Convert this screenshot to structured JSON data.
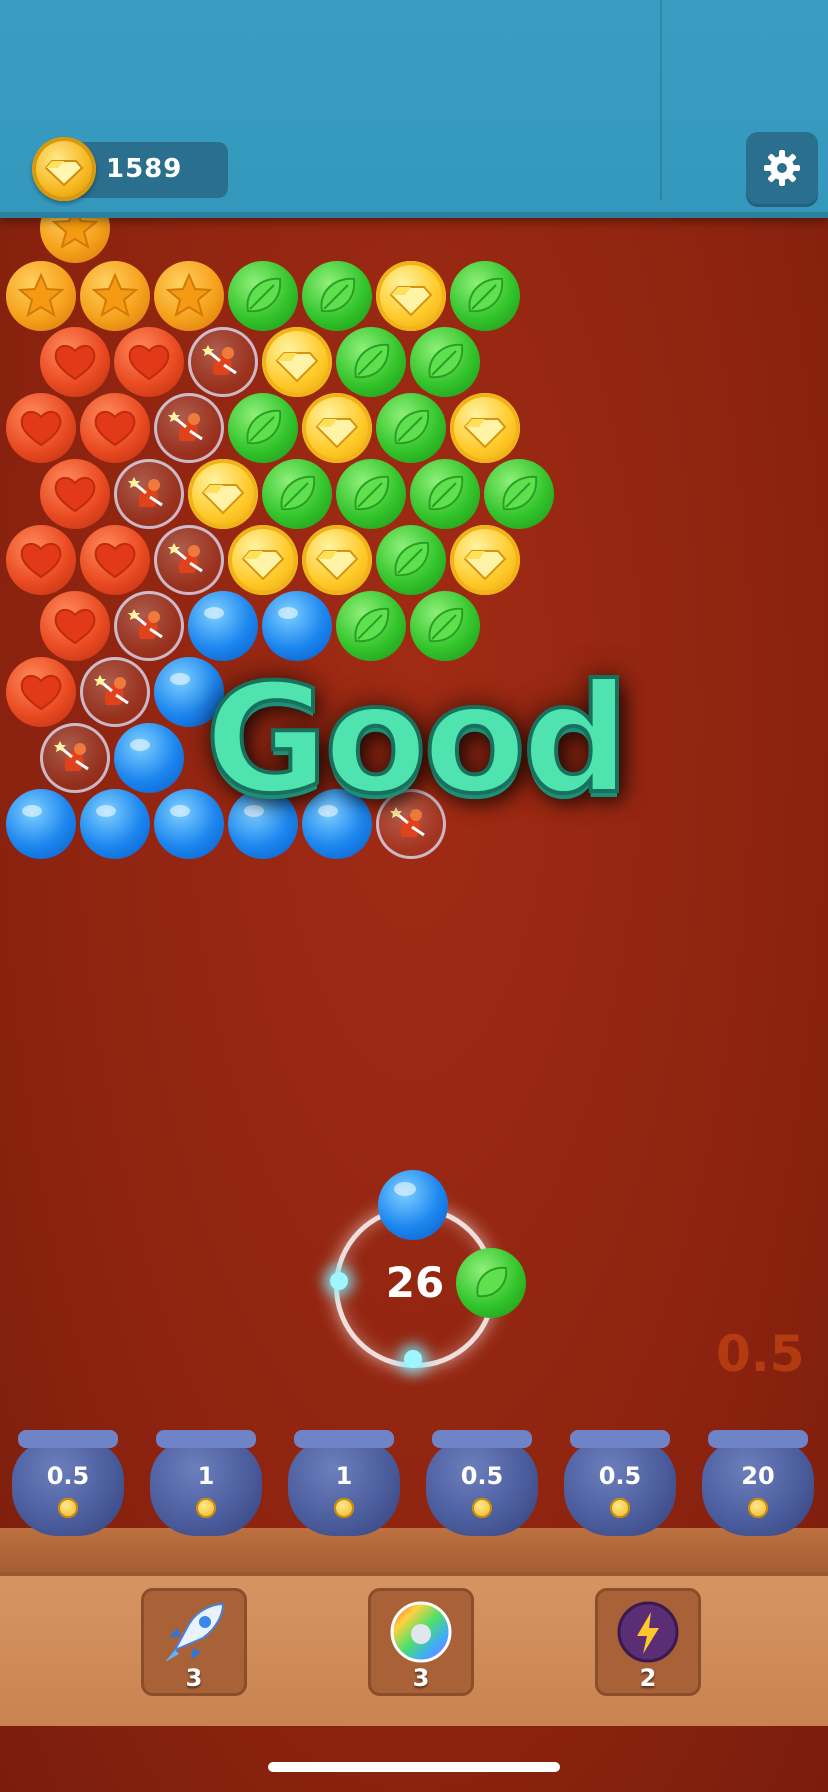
{
  "hud": {
    "coins": "1589",
    "coin_icon": "gem-coin-icon",
    "settings_icon": "gear-icon"
  },
  "board": {
    "bubble_kinds": {
      "red": "heart",
      "orange": "star",
      "green": "leaf",
      "blue": "plain",
      "gold": "gem",
      "clear": "fairy"
    },
    "colors": {
      "red": "#ea4b22",
      "orange": "#f6a21c",
      "green": "#34c52c",
      "blue": "#1c86ef",
      "gold": "#ffc928"
    }
  },
  "feedback": {
    "text": "Good"
  },
  "shooter": {
    "shots_left": "26",
    "current_bubble": "blue",
    "next_bubble": "green"
  },
  "floating_multiplier": "0.5",
  "pots": [
    {
      "value": "0.5"
    },
    {
      "value": "1"
    },
    {
      "value": "1"
    },
    {
      "value": "0.5"
    },
    {
      "value": "0.5"
    },
    {
      "value": "20"
    }
  ],
  "boosters": [
    {
      "icon": "rocket-icon",
      "count": "3"
    },
    {
      "icon": "rainbow-bubble-icon",
      "count": "3"
    },
    {
      "icon": "lightning-bomb-icon",
      "count": "2"
    }
  ]
}
